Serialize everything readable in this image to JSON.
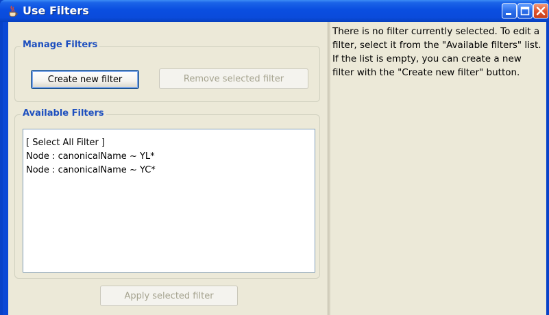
{
  "window": {
    "title": "Use Filters",
    "icons": {
      "app": "java-coffee-cup-icon",
      "minimize": "minimize-icon",
      "maximize": "maximize-icon",
      "close": "close-icon"
    }
  },
  "manage_filters": {
    "title": "Manage Filters",
    "create_button": "Create new filter",
    "remove_button": "Remove selected filter"
  },
  "available_filters": {
    "title": "Available Filters",
    "items": [
      "[ Select All Filter ]",
      "Node : canonicalName ~ YL*",
      "Node : canonicalName ~ YC*"
    ]
  },
  "apply_button": "Apply selected filter",
  "description": "There is no filter currently selected. To edit a filter, select it from the \"Available filters\" list. If the list is empty, you can create a new filter with the \"Create new filter\" button.",
  "colors": {
    "titlebar": "#0a4ee0",
    "group_title": "#1d4fbf",
    "panel_bg": "#ece9d8",
    "disabled_text": "#a5a38f"
  }
}
